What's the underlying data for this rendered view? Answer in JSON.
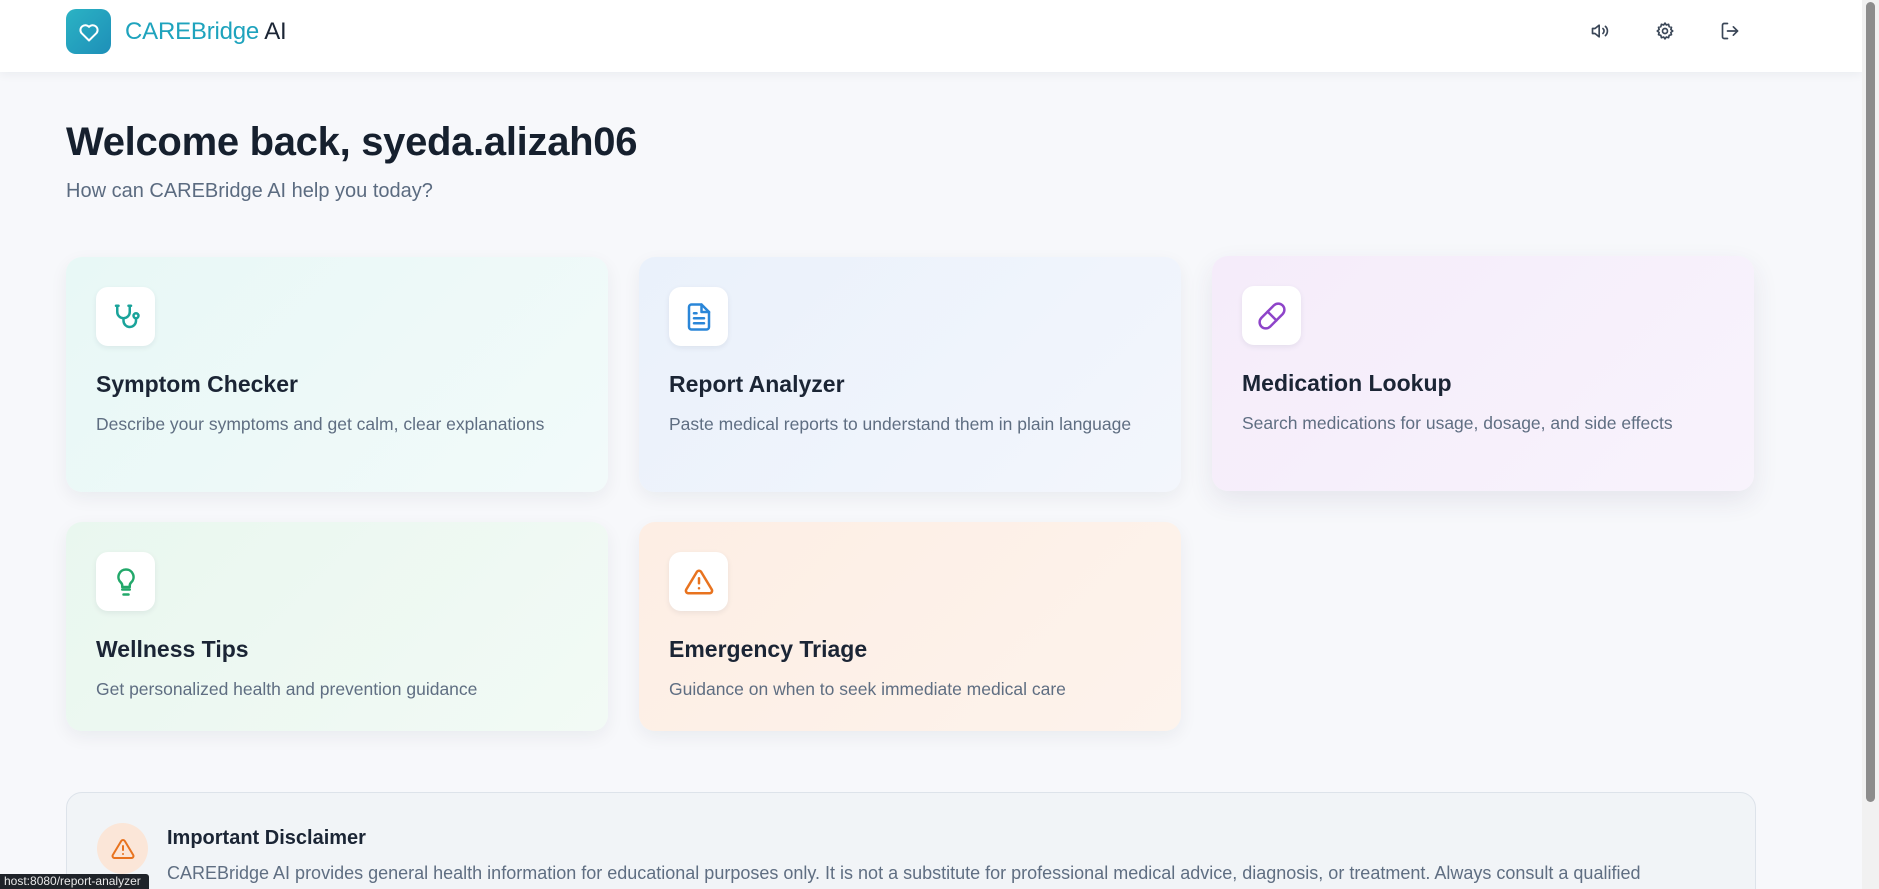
{
  "header": {
    "brand_part1": "CAREBridge",
    "brand_part2": "AI",
    "actions": [
      {
        "name": "audio",
        "icon": "speaker-icon"
      },
      {
        "name": "settings",
        "icon": "gear-icon"
      },
      {
        "name": "logout",
        "icon": "logout-icon"
      }
    ]
  },
  "welcome": {
    "title": "Welcome back, syeda.alizah06",
    "subtitle": "How can CAREBridge AI help you today?"
  },
  "cards": [
    {
      "title": "Symptom Checker",
      "description": "Describe your symptoms and get calm, clear explanations",
      "icon": "stethoscope-icon",
      "color": "#1aa39a"
    },
    {
      "title": "Report Analyzer",
      "description": "Paste medical reports to understand them in plain language",
      "icon": "document-icon",
      "color": "#2a86d8"
    },
    {
      "title": "Medication Lookup",
      "description": "Search medications for usage, dosage, and side effects",
      "icon": "pill-icon",
      "color": "#8e44c9"
    },
    {
      "title": "Wellness Tips",
      "description": "Get personalized health and prevention guidance",
      "icon": "lightbulb-icon",
      "color": "#22a86a"
    },
    {
      "title": "Emergency Triage",
      "description": "Guidance on when to seek immediate medical care",
      "icon": "warning-icon",
      "color": "#e8731f"
    }
  ],
  "disclaimer": {
    "title": "Important Disclaimer",
    "text": "CAREBridge AI provides general health information for educational purposes only. It is not a substitute for professional medical advice, diagnosis, or treatment. Always consult a qualified",
    "icon": "warning-icon",
    "color": "#e8731f"
  },
  "status_bar": {
    "url": "host:8080/report-analyzer"
  },
  "colors": {
    "brand_teal": "#1ea3bd",
    "page_bg": "#f7f8fb"
  }
}
